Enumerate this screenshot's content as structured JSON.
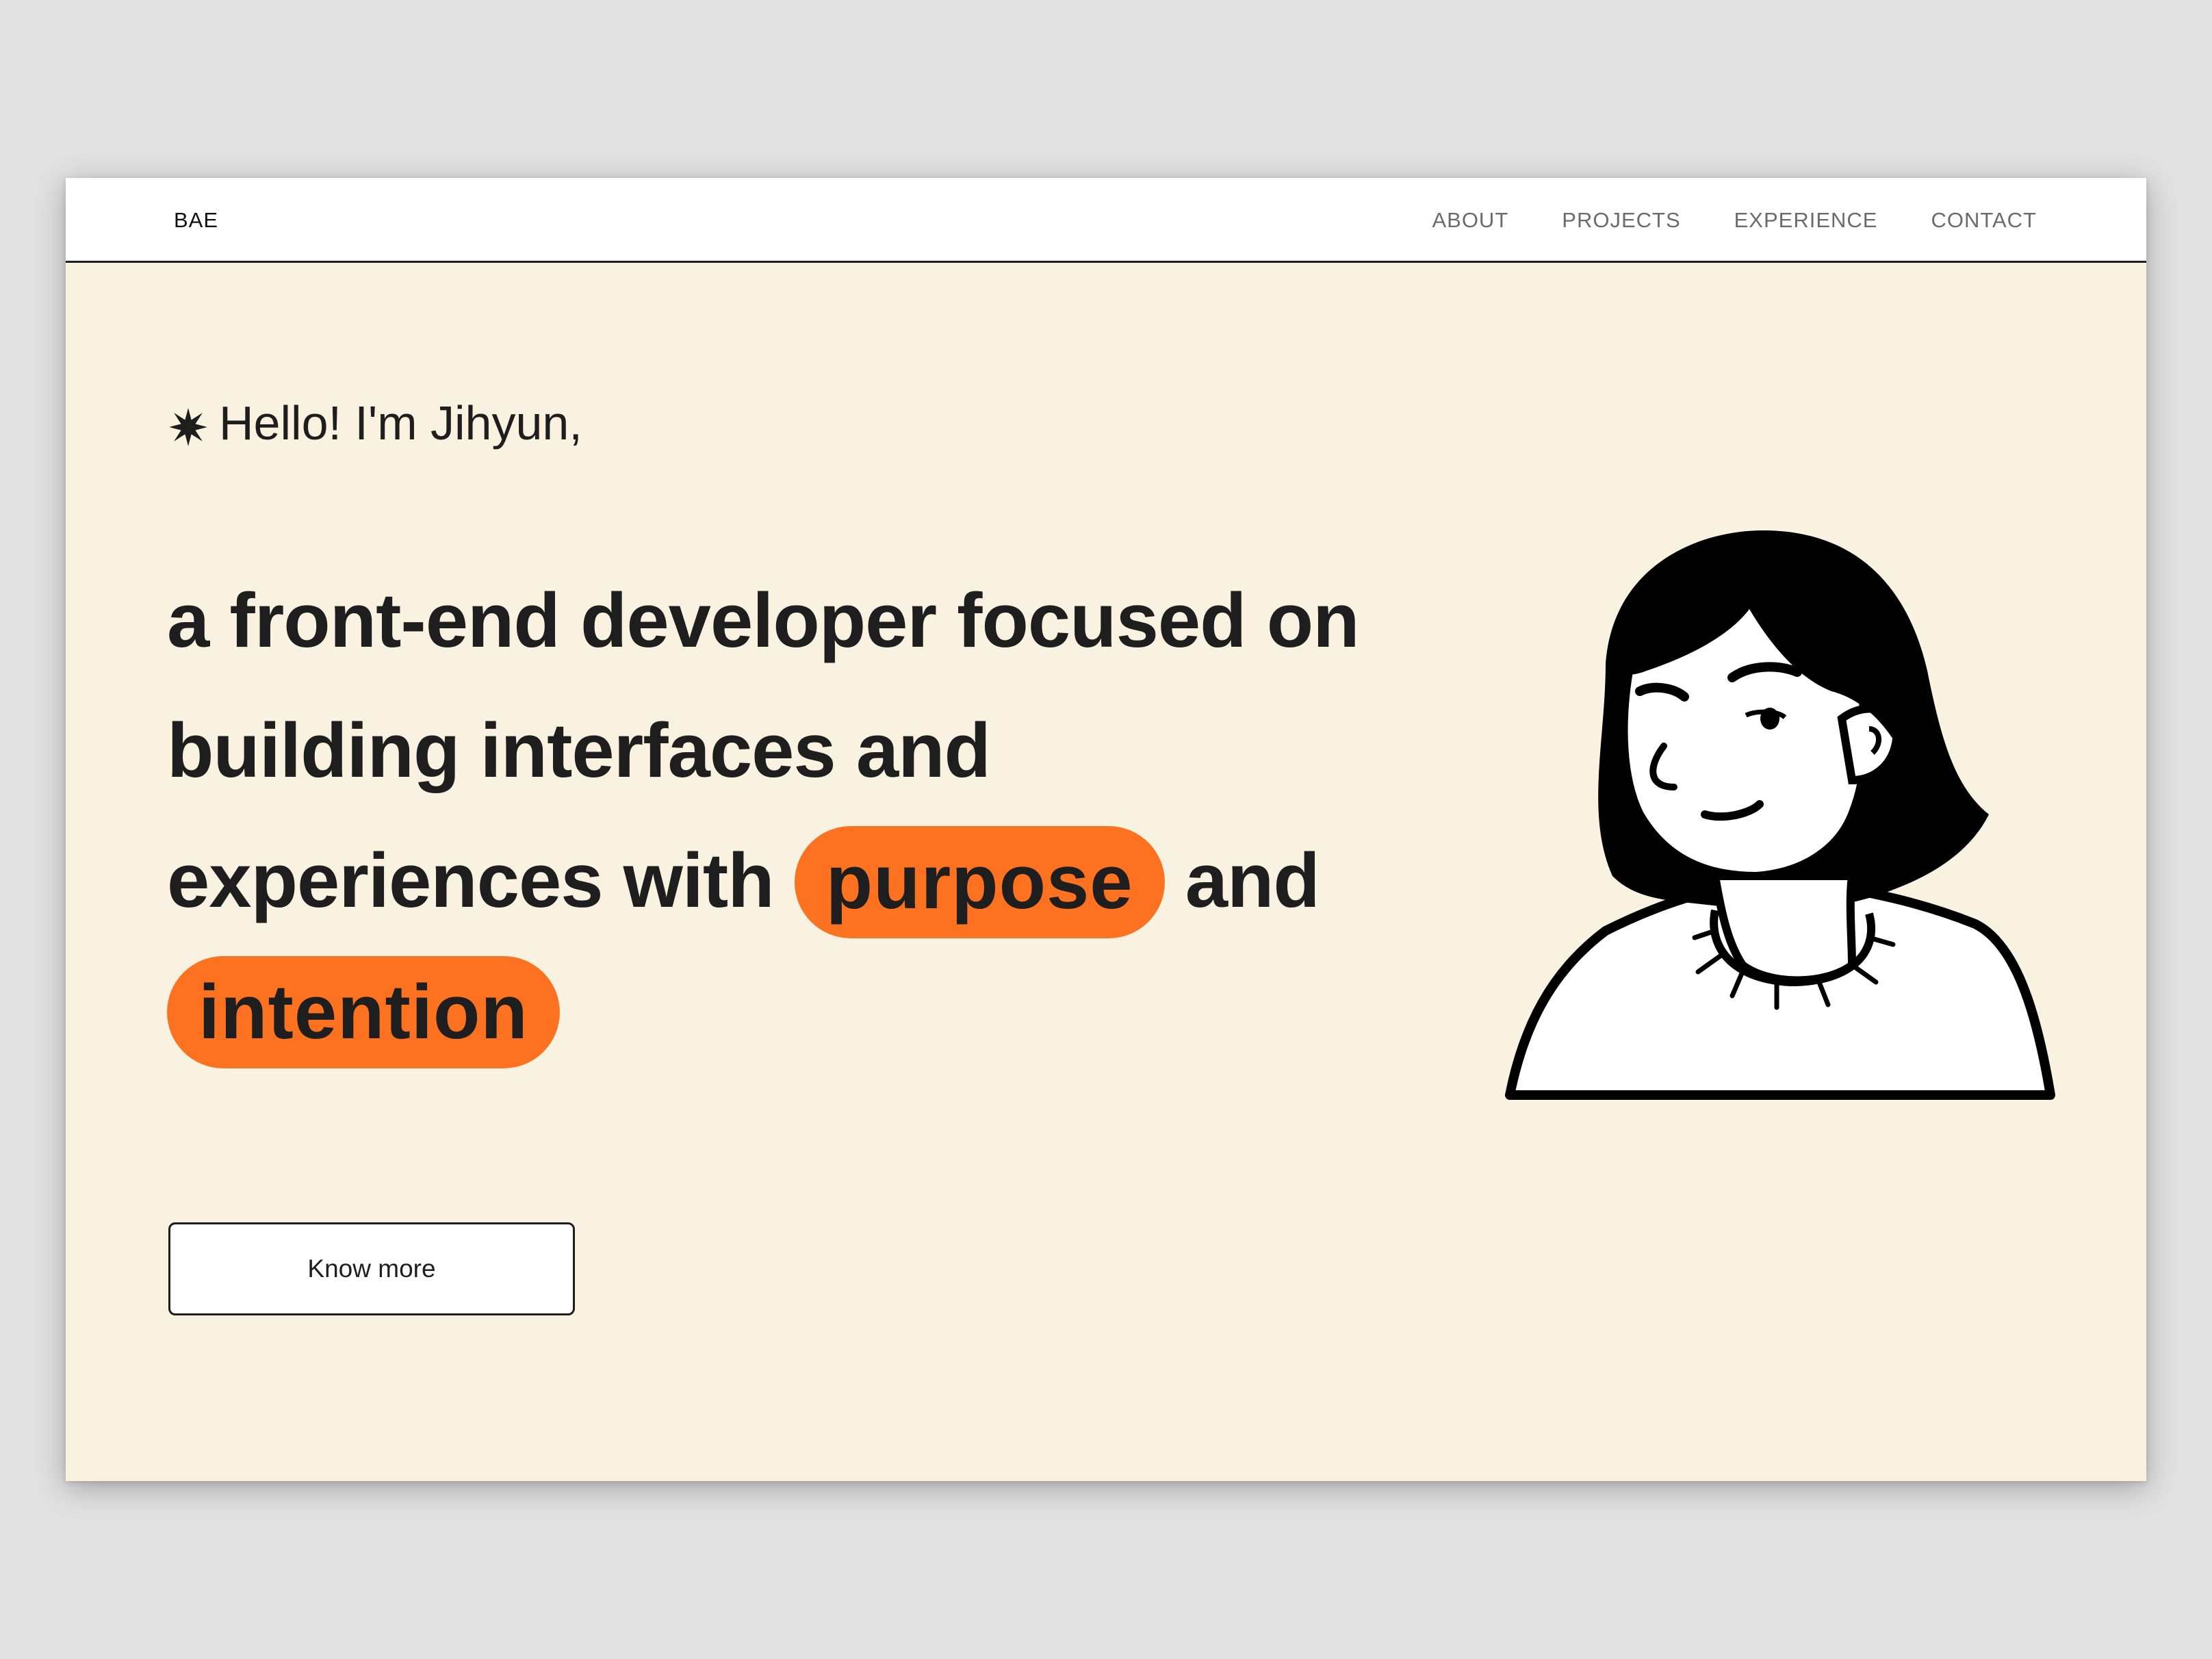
{
  "nav": {
    "logo": "BAE",
    "links": [
      "ABOUT",
      "PROJECTS",
      "EXPERIENCE",
      "CONTACT"
    ]
  },
  "hero": {
    "greeting": "Hello! I'm Jihyun,",
    "line1": "a front-end developer focused on",
    "line2": "building interfaces and",
    "line3_prefix": "experiences with",
    "highlight1": "purpose",
    "line3_suffix": "and",
    "highlight2": "intention",
    "cta_label": "Know more"
  },
  "colors": {
    "background": "#faf2e1",
    "accent": "#fd7220",
    "text": "#1e1e1e"
  },
  "icons": {
    "greeting_icon": "star-burst-icon",
    "illustration": "woman-portrait-illustration"
  }
}
